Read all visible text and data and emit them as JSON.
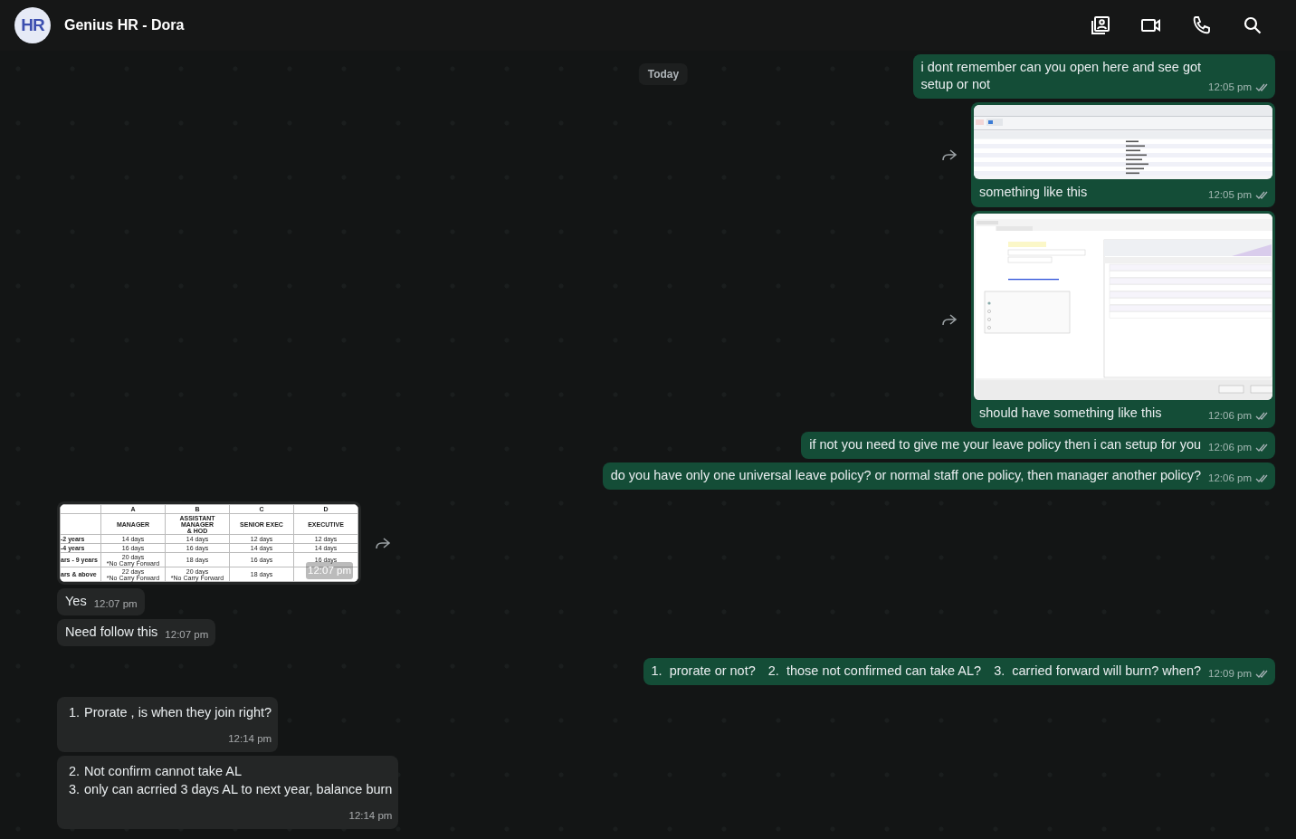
{
  "header": {
    "avatar_text": "HR",
    "title": "Genius HR - Dora"
  },
  "date_chip": "Today",
  "messages": [
    {
      "outgoing": true,
      "kind": "text",
      "text": "i dont remember can you open here and see got\nsetup or not",
      "time": "12:05 pm",
      "delivered": true
    },
    {
      "outgoing": true,
      "kind": "screenshot",
      "caption": "something like this",
      "time": "12:05 pm",
      "delivered": true
    },
    {
      "outgoing": true,
      "kind": "window",
      "caption": "should have something like this",
      "time": "12:06 pm",
      "delivered": true
    },
    {
      "outgoing": true,
      "kind": "text",
      "text": "if not you need to give me your leave policy then i can setup for you",
      "time": "12:06 pm",
      "delivered": true
    },
    {
      "outgoing": true,
      "kind": "text",
      "text": "do you have only one universal leave policy? or normal staff one policy, then manager another policy?",
      "time": "12:06 pm",
      "delivered": true
    },
    {
      "outgoing": false,
      "kind": "sheet",
      "table": {
        "letters": [
          "A",
          "B",
          "C",
          "D"
        ],
        "headings": [
          "MANAGER",
          "ASSISTANT MANAGER\n& HOD",
          "SENIOR EXEC",
          "EXECUTIVE"
        ],
        "rows": [
          {
            "label": "-2 years",
            "cells": [
              "14 days",
              "14 days",
              "12 days",
              "12 days"
            ]
          },
          {
            "label": "-4 years",
            "cells": [
              "16 days",
              "16 days",
              "14 days",
              "14 days"
            ]
          },
          {
            "label": "ars - 9 years",
            "cells": [
              "20 days\n*No Carry Forward",
              "18 days",
              "16 days",
              "16 days"
            ]
          },
          {
            "label": "ars & above",
            "cells": [
              "22 days\n*No Carry Forward",
              "20 days\n*No Carry Forward",
              "18 days"
            ]
          }
        ]
      },
      "time": "12:07 pm"
    },
    {
      "outgoing": false,
      "kind": "text",
      "text": "Yes",
      "time": "12:07 pm"
    },
    {
      "outgoing": false,
      "kind": "text",
      "text": "Need follow this",
      "time": "12:07 pm"
    },
    {
      "outgoing": true,
      "kind": "inline-list",
      "items": [
        {
          "number": "1.",
          "text": "prorate or not?"
        },
        {
          "number": "2.",
          "text": "those not confirmed can take AL?"
        },
        {
          "number": "3.",
          "text": "carried forward will burn? when?"
        }
      ],
      "time": "12:09 pm",
      "delivered": true
    },
    {
      "outgoing": false,
      "kind": "list",
      "items": [
        {
          "number": "1.",
          "text": "Prorate , is when they join right?"
        }
      ],
      "time": "12:14 pm"
    },
    {
      "outgoing": false,
      "kind": "list",
      "items": [
        {
          "number": "2.",
          "text": "Not confirm cannot take AL"
        },
        {
          "number": "3.",
          "text": "only can acrried 3 days AL to next year, balance burn"
        }
      ],
      "time": "12:14 pm"
    }
  ]
}
